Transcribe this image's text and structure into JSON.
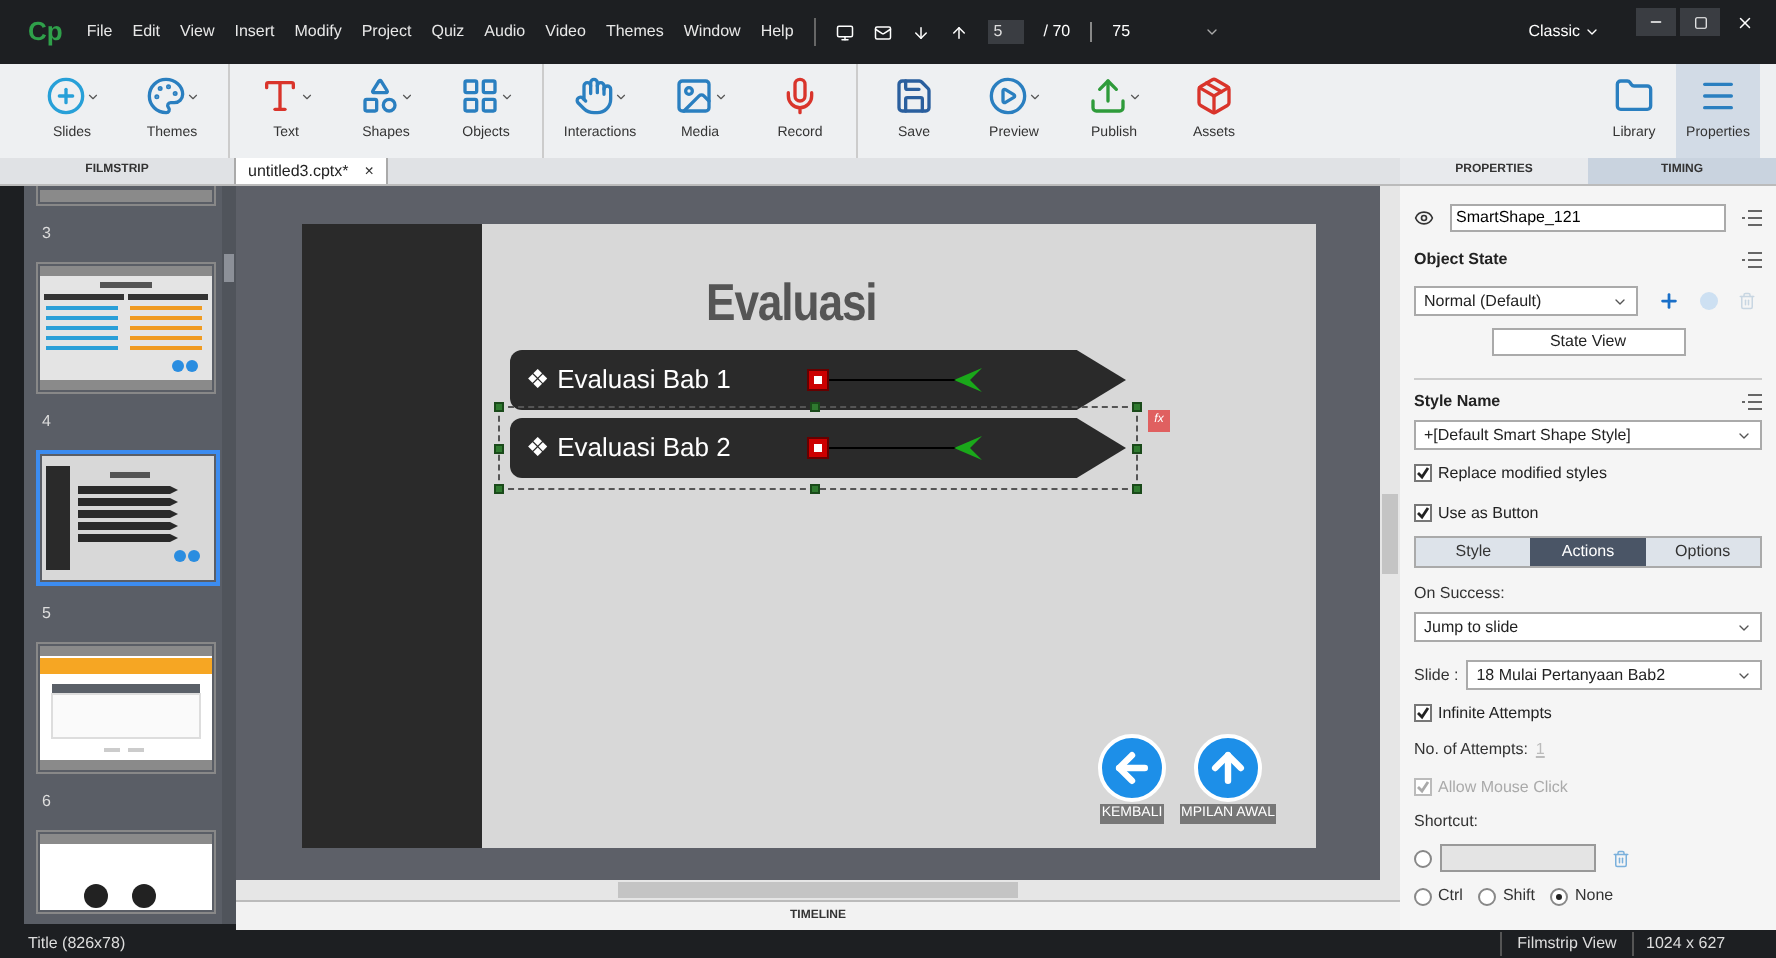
{
  "menu_bar": {
    "logo": "Cp",
    "items": [
      "File",
      "Edit",
      "View",
      "Insert",
      "Modify",
      "Project",
      "Quiz",
      "Audio",
      "Video",
      "Themes",
      "Window",
      "Help"
    ],
    "current_slide": "5",
    "slide_total": "/ 70",
    "zoom": "75",
    "workspace": "Classic"
  },
  "toolbar": {
    "groups": [
      [
        {
          "label": "Slides",
          "caret": true
        },
        {
          "label": "Themes",
          "caret": true
        }
      ],
      [
        {
          "label": "Text",
          "caret": true
        },
        {
          "label": "Shapes",
          "caret": true
        },
        {
          "label": "Objects",
          "caret": true
        }
      ],
      [
        {
          "label": "Interactions",
          "caret": true
        },
        {
          "label": "Media",
          "caret": true
        },
        {
          "label": "Record",
          "caret": false
        }
      ],
      [
        {
          "label": "Save",
          "caret": false
        },
        {
          "label": "Preview",
          "caret": true
        },
        {
          "label": "Publish",
          "caret": true
        },
        {
          "label": "Assets",
          "caret": false
        }
      ]
    ],
    "right": [
      {
        "label": "Library",
        "selected": false
      },
      {
        "label": "Properties",
        "selected": true
      }
    ]
  },
  "filmstrip": {
    "title": "FILMSTRIP",
    "slides": [
      {
        "number": "3",
        "kind": "partial",
        "selected": false
      },
      {
        "number": "4",
        "kind": "menu",
        "selected": false
      },
      {
        "number": "5",
        "kind": "eval",
        "selected": true
      },
      {
        "number": "6",
        "kind": "table",
        "selected": false
      },
      {
        "kind": "circles",
        "selected": false
      }
    ]
  },
  "document_tab": {
    "title": "untitled3.cptx*",
    "close": "×"
  },
  "slide": {
    "title": "Evaluasi",
    "buttons": [
      {
        "label": "❖ Evaluasi Bab 1",
        "selected": false
      },
      {
        "label": "❖ Evaluasi Bab 2",
        "selected": true
      }
    ],
    "function_mark": "fx",
    "nav": [
      {
        "kind": "back",
        "label": "KEMBALI"
      },
      {
        "kind": "home",
        "label": "MPILAN AWAL"
      }
    ]
  },
  "timeline": "TIMELINE",
  "panel_tabs": [
    {
      "label": "PROPERTIES",
      "selected": true
    },
    {
      "label": "TIMING",
      "selected": false
    }
  ],
  "properties": {
    "name": "SmartShape_121",
    "object_state_title": "Object State",
    "state": "Normal (Default)",
    "state_view": "State View",
    "style_name_title": "Style Name",
    "style": "+[Default Smart Shape Style]",
    "style_checks": [
      {
        "label": "Replace modified styles",
        "checked": true
      },
      {
        "label": "Use as Button",
        "checked": true
      }
    ],
    "tabs": [
      {
        "label": "Style",
        "selected": false
      },
      {
        "label": "Actions",
        "selected": true
      },
      {
        "label": "Options",
        "selected": false
      }
    ],
    "on_success_label": "On Success:",
    "on_success": "Jump to slide",
    "slide_label": "Slide :",
    "slide": "18 Mulai Pertanyaan Bab2",
    "infinite": {
      "label": "Infinite Attempts",
      "checked": true
    },
    "attempts_label": "No. of Attempts:",
    "attempts": "1",
    "attempts_disabled": true,
    "mouse_click": {
      "label": "Allow Mouse Click",
      "checked": true,
      "disabled": true
    },
    "shortcut_label": "Shortcut:",
    "shortcut_key": {
      "selected": false
    },
    "modifiers": [
      {
        "label": "Ctrl",
        "selected": false
      },
      {
        "label": "Shift",
        "selected": false
      },
      {
        "label": "None",
        "selected": true
      }
    ]
  },
  "status_bar": {
    "left": "Title (826x78)",
    "view": "Filmstrip View",
    "size": "1024 x 627"
  }
}
